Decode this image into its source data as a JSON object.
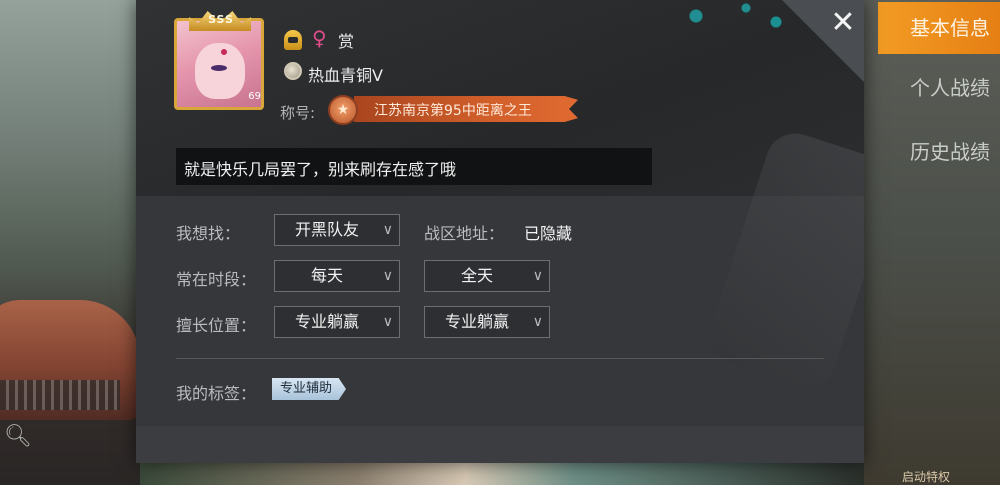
{
  "right_nav": {
    "items": [
      {
        "label": "基本信息",
        "active": true
      },
      {
        "label": "个人战绩",
        "active": false
      },
      {
        "label": "历史战绩",
        "active": false
      }
    ],
    "privilege_text": "启动特权"
  },
  "profile": {
    "avatar_rank_label": "SSS",
    "avatar_level": "69",
    "reward_text": "赏",
    "gender_icon": "female-icon",
    "rank_name": "热血青铜Ⅴ",
    "title_label": "称号:",
    "title_text": "江苏南京第95中距离之王",
    "signature": "就是快乐几局罢了，别来刷存在感了哦"
  },
  "form": {
    "looking_for": {
      "label": "我想找：",
      "value": "开黑队友"
    },
    "region": {
      "label": "战区地址：",
      "value": "已隐藏"
    },
    "active_time": {
      "label": "常在时段：",
      "day_value": "每天",
      "hour_value": "全天"
    },
    "position": {
      "label": "擅长位置：",
      "value1": "专业躺赢",
      "value2": "专业躺赢"
    },
    "tags": {
      "label": "我的标签：",
      "items": [
        "专业辅助"
      ]
    }
  },
  "colors": {
    "accent": "#f39c24",
    "title_banner": "#d15f2a",
    "gender": "#e04c8a"
  }
}
